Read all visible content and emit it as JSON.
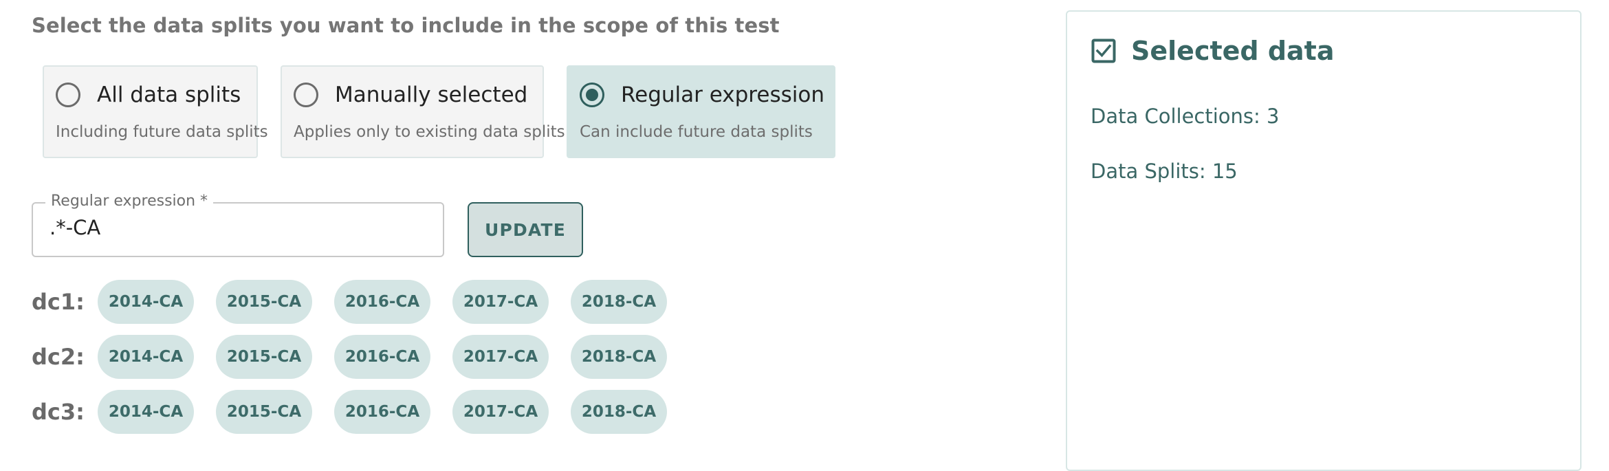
{
  "intro_text": "Select the data splits you want to include in the scope of this test",
  "scope_options": [
    {
      "label": "All data splits",
      "sublabel": "Including future data splits",
      "selected": false
    },
    {
      "label": "Manually selected",
      "sublabel": "Applies only to existing data splits",
      "selected": false
    },
    {
      "label": "Regular expression",
      "sublabel": "Can include future data splits",
      "selected": true
    }
  ],
  "regex_field": {
    "label": "Regular expression *",
    "value": ".*-CA"
  },
  "update_button_label": "UPDATE",
  "collections": [
    {
      "label": "dc1:",
      "splits": [
        "2014-CA",
        "2015-CA",
        "2016-CA",
        "2017-CA",
        "2018-CA"
      ]
    },
    {
      "label": "dc2:",
      "splits": [
        "2014-CA",
        "2015-CA",
        "2016-CA",
        "2017-CA",
        "2018-CA"
      ]
    },
    {
      "label": "dc3:",
      "splits": [
        "2014-CA",
        "2015-CA",
        "2016-CA",
        "2017-CA",
        "2018-CA"
      ]
    }
  ],
  "summary_panel": {
    "icon": "checkbox-checked-icon",
    "title": "Selected data",
    "collections_text": "Data Collections: 3",
    "splits_text": "Data Splits: 15"
  },
  "colors": {
    "accent": "#2f5f5d",
    "accent_text": "#3a6765",
    "chip_bg": "#d4e5e4"
  }
}
